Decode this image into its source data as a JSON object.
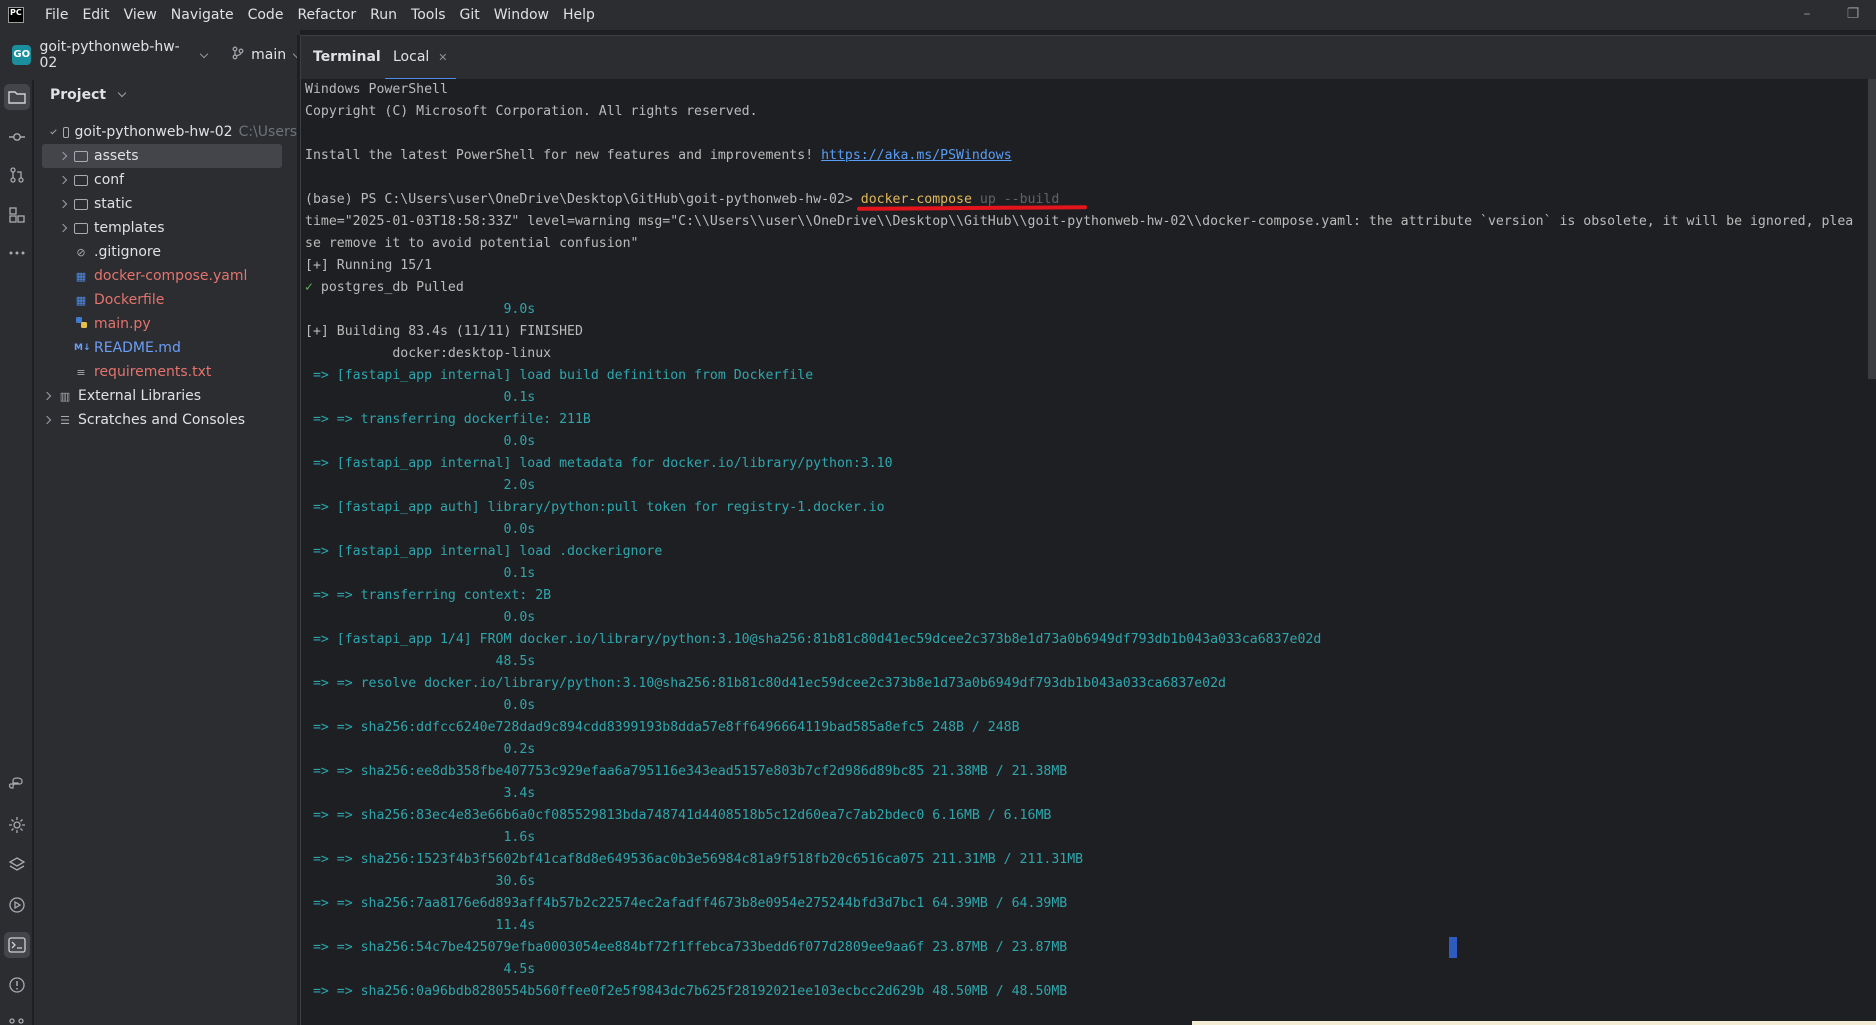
{
  "menu": [
    "File",
    "Edit",
    "View",
    "Navigate",
    "Code",
    "Refactor",
    "Run",
    "Tools",
    "Git",
    "Window",
    "Help"
  ],
  "project_bar": {
    "badge": "GO",
    "name": "goit-pythonweb-hw-02",
    "branch": "main"
  },
  "panel": {
    "title": "Project",
    "root": {
      "name": "goit-pythonweb-hw-02",
      "path_hint": "C:\\Users"
    },
    "items": [
      {
        "label": "assets"
      },
      {
        "label": "conf"
      },
      {
        "label": "static"
      },
      {
        "label": "templates"
      },
      {
        "label": ".gitignore"
      },
      {
        "label": "docker-compose.yaml"
      },
      {
        "label": "Dockerfile"
      },
      {
        "label": "main.py"
      },
      {
        "label": "README.md"
      },
      {
        "label": "requirements.txt"
      }
    ],
    "external": "External Libraries",
    "scratches": "Scratches and Consoles"
  },
  "terminal": {
    "title": "Terminal",
    "tab_label": "Local",
    "lines": [
      "Windows PowerShell",
      "Copyright (C) Microsoft Corporation. All rights reserved.",
      "",
      "Install the latest PowerShell for new features and improvements! ",
      "",
      "(base) PS C:\\Users\\user\\OneDrive\\Desktop\\GitHub\\goit-pythonweb-hw-02> ",
      "time=\"2025-01-03T18:58:33Z\" level=warning msg=\"C:\\\\Users\\\\user\\\\OneDrive\\\\Desktop\\\\GitHub\\\\goit-pythonweb-hw-02\\\\docker-compose.yaml: the attribute `version` is obsolete, it will be ignored, plea",
      "se remove it to avoid potential confusion\"",
      "[+] Running 15/1",
      " postgres_db Pulled",
      "                         9.0s",
      "[+] Building 83.4s (11/11) FINISHED",
      "           docker:desktop-linux",
      " => [fastapi_app internal] load build definition from Dockerfile",
      "                         0.1s",
      " => => transferring dockerfile: 211B",
      "                         0.0s",
      " => [fastapi_app internal] load metadata for docker.io/library/python:3.10",
      "                         2.0s",
      " => [fastapi_app auth] library/python:pull token for registry-1.docker.io",
      "                         0.0s",
      " => [fastapi_app internal] load .dockerignore",
      "                         0.1s",
      " => => transferring context: 2B",
      "                         0.0s",
      " => [fastapi_app 1/4] FROM docker.io/library/python:3.10@sha256:81b81c80d41ec59dcee2c373b8e1d73a0b6949df793db1b043a033ca6837e02d",
      "                        48.5s",
      " => => resolve docker.io/library/python:3.10@sha256:81b81c80d41ec59dcee2c373b8e1d73a0b6949df793db1b043a033ca6837e02d",
      "                         0.0s",
      " => => sha256:ddfcc6240e728dad9c894cdd8399193b8dda57e8ff6496664119bad585a8efc5 248B / 248B",
      "                         0.2s",
      " => => sha256:ee8db358fbe407753c929efaa6a795116e343ead5157e803b7cf2d986d89bc85 21.38MB / 21.38MB",
      "                         3.4s",
      " => => sha256:83ec4e83e66b6a0cf085529813bda748741d4408518b5c12d60ea7c7ab2bdec0 6.16MB / 6.16MB",
      "                         1.6s",
      " => => sha256:1523f4b3f5602bf41caf8d8e649536ac0b3e56984c81a9f518fb20c6516ca075 211.31MB / 211.31MB",
      "                        30.6s",
      " => => sha256:7aa8176e6d893aff4b57b2c22574ec2afadff4673b8e0954e275244bfd3d7bc1 64.39MB / 64.39MB",
      "                        11.4s",
      " => => sha256:54c7be425079efba0003054ee884bf72f1ffebca733bedd6f077d2809ee9aa6f 23.87MB / 23.87MB",
      "                         4.5s",
      " => => sha256:0a96bdb8280554b560ffee0f2e5f9843dc7b625f28192021ee103ecbcc2d629b 48.50MB / 48.50MB"
    ],
    "link": "https://aka.ms/PSWindows",
    "command": {
      "name": "docker-compose",
      "args": " up --build"
    },
    "check": "✓"
  }
}
